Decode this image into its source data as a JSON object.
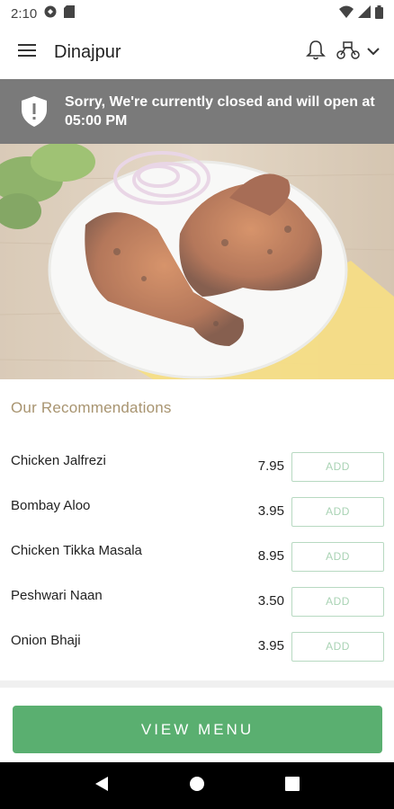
{
  "status_bar": {
    "time": "2:10"
  },
  "header": {
    "title": "Dinajpur"
  },
  "banner": {
    "message": "Sorry, We're currently closed and will open at 05:00 PM"
  },
  "recommendations": {
    "title": "Our Recommendations",
    "items": [
      {
        "name": "Chicken Jalfrezi",
        "price": "7.95",
        "add_label": "ADD"
      },
      {
        "name": "Bombay Aloo",
        "price": "3.95",
        "add_label": "ADD"
      },
      {
        "name": "Chicken Tikka Masala",
        "price": "8.95",
        "add_label": "ADD"
      },
      {
        "name": "Peshwari Naan",
        "price": "3.50",
        "add_label": "ADD"
      },
      {
        "name": "Onion Bhaji",
        "price": "3.95",
        "add_label": "ADD"
      }
    ]
  },
  "footer": {
    "view_menu_label": "VIEW MENU"
  },
  "colors": {
    "accent": "#5aaf70",
    "banner": "#7a7a7a",
    "section_title": "#a89470",
    "add_border": "#b7d9c1"
  },
  "icons": [
    "menu-icon",
    "bell-icon",
    "delivery-scooter-icon",
    "chevron-down-icon",
    "shield-alert-icon",
    "back-icon",
    "home-icon",
    "recents-icon"
  ]
}
